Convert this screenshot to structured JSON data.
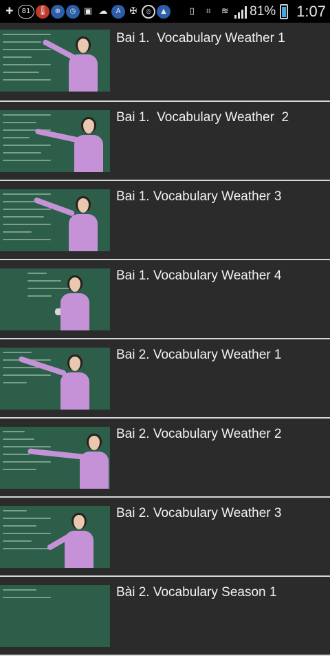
{
  "status_bar": {
    "notification_count": "81",
    "battery_percent": "81%",
    "battery_level": 0.81,
    "time": "1:07",
    "icons": [
      "plus-icon",
      "notification-count-badge",
      "thermometer-icon",
      "lock-icon",
      "clock-icon",
      "image-icon",
      "cloud-download-icon",
      "app-a-icon",
      "game-controller-icon",
      "camera-icon",
      "app-nav-icon",
      "vibrate-icon",
      "nfc-icon",
      "wifi-icon",
      "signal-icon",
      "battery-icon"
    ]
  },
  "videos": [
    {
      "title": "Bai 1.  Vocabulary Weather 1"
    },
    {
      "title": "Bai 1.  Vocabulary Weather  2"
    },
    {
      "title": "Bai 1. Vocabulary Weather 3"
    },
    {
      "title": "Bai 1. Vocabulary Weather 4"
    },
    {
      "title": "Bai 2. Vocabulary Weather 1"
    },
    {
      "title": "Bai 2. Vocabulary Weather 2"
    },
    {
      "title": "Bai 2. Vocabulary Weather 3"
    },
    {
      "title": "Bài 2. Vocabulary Season 1"
    }
  ],
  "colors": {
    "background": "#2b2b2b",
    "divider": "#d8d8d8",
    "chalkboard": "#2c5e4a",
    "teacher_shirt": "#c592d8",
    "battery_fill": "#3fa9e0"
  }
}
